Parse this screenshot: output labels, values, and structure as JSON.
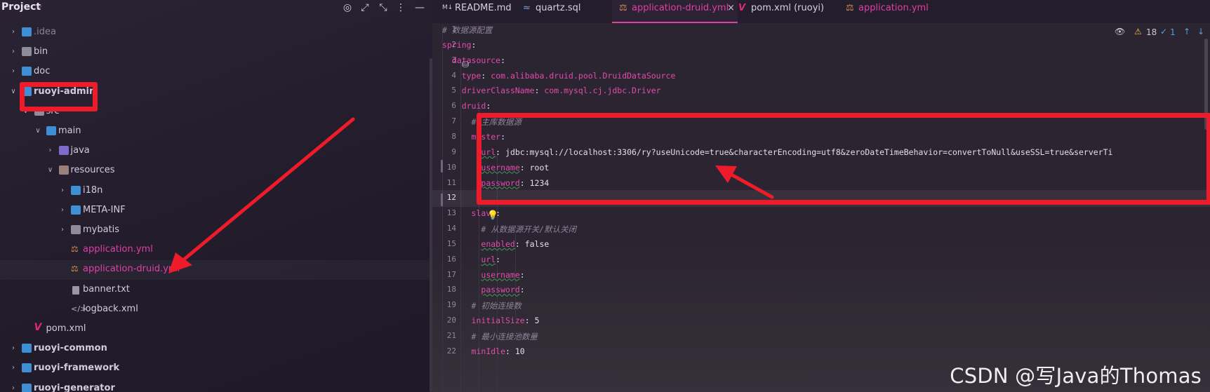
{
  "project": {
    "title": "Project",
    "tree": [
      {
        "label": ".idea",
        "depth": 0,
        "icon": "folder-icon",
        "expanded": false
      },
      {
        "label": "bin",
        "depth": 0,
        "icon": "folder-icon",
        "expanded": false
      },
      {
        "label": "doc",
        "depth": 0,
        "icon": "folder-icon",
        "expanded": false
      },
      {
        "label": "ruoyi-admin",
        "depth": 0,
        "icon": "module-icon",
        "expanded": true
      },
      {
        "label": "src",
        "depth": 1,
        "icon": "folder-icon",
        "expanded": true
      },
      {
        "label": "main",
        "depth": 2,
        "icon": "folder-icon",
        "expanded": true
      },
      {
        "label": "java",
        "depth": 3,
        "icon": "source-folder-icon",
        "expanded": false
      },
      {
        "label": "resources",
        "depth": 3,
        "icon": "resources-folder-icon",
        "expanded": true
      },
      {
        "label": "i18n",
        "depth": 4,
        "icon": "folder-icon",
        "expanded": false
      },
      {
        "label": "META-INF",
        "depth": 4,
        "icon": "folder-icon",
        "expanded": false
      },
      {
        "label": "mybatis",
        "depth": 4,
        "icon": "folder-icon",
        "expanded": false
      },
      {
        "label": "application.yml",
        "depth": 4,
        "icon": "yaml-file-icon"
      },
      {
        "label": "application-druid.yml",
        "depth": 4,
        "icon": "yaml-file-icon"
      },
      {
        "label": "banner.txt",
        "depth": 4,
        "icon": "text-file-icon"
      },
      {
        "label": "logback.xml",
        "depth": 4,
        "icon": "xml-file-icon"
      },
      {
        "label": "pom.xml",
        "depth": 1,
        "icon": "maven-icon"
      },
      {
        "label": "ruoyi-common",
        "depth": 0,
        "icon": "module-icon",
        "expanded": false
      },
      {
        "label": "ruoyi-framework",
        "depth": 0,
        "icon": "module-icon",
        "expanded": false
      },
      {
        "label": "ruoyi-generator",
        "depth": 0,
        "icon": "module-icon",
        "expanded": false
      }
    ]
  },
  "tabs": [
    {
      "label": "README.md",
      "icon": "markdown-icon"
    },
    {
      "label": "quartz.sql",
      "icon": "sql-icon"
    },
    {
      "label": "application-druid.yml",
      "icon": "yaml-file-icon",
      "active": true,
      "close": "×"
    },
    {
      "label": "pom.xml (ruoyi)",
      "icon": "maven-icon"
    },
    {
      "label": "application.yml",
      "icon": "yaml-file-icon"
    }
  ],
  "inspections": {
    "warnings": "18",
    "weak_warnings": "1"
  },
  "lines": [
    {
      "n": "1",
      "parts": [
        [
          "cmt",
          "# 数据源配置"
        ]
      ]
    },
    {
      "n": "2",
      "parts": [
        [
          "k",
          "spring"
        ],
        [
          "v",
          ":"
        ]
      ]
    },
    {
      "n": "3",
      "parts": [
        [
          "v",
          "  "
        ],
        [
          "k",
          "datasource"
        ],
        [
          "v",
          ":"
        ]
      ]
    },
    {
      "n": "4",
      "parts": [
        [
          "v",
          "    "
        ],
        [
          "k",
          "type"
        ],
        [
          "v",
          ": "
        ],
        [
          "cls",
          "com.alibaba.druid.pool.DruidDataSource"
        ]
      ]
    },
    {
      "n": "5",
      "parts": [
        [
          "v",
          "    "
        ],
        [
          "k",
          "driverClassName"
        ],
        [
          "v",
          ": "
        ],
        [
          "cls",
          "com.mysql.cj.jdbc.Driver"
        ]
      ]
    },
    {
      "n": "6",
      "parts": [
        [
          "v",
          "    "
        ],
        [
          "k",
          "druid"
        ],
        [
          "v",
          ":"
        ]
      ]
    },
    {
      "n": "7",
      "parts": [
        [
          "v",
          "      "
        ],
        [
          "cmt",
          "# 主库数据源"
        ]
      ]
    },
    {
      "n": "8",
      "parts": [
        [
          "v",
          "      "
        ],
        [
          "k",
          "master"
        ],
        [
          "v",
          ":"
        ]
      ]
    },
    {
      "n": "9",
      "parts": [
        [
          "v",
          "        "
        ],
        [
          "k sq",
          "url"
        ],
        [
          "v",
          ": jdbc:mysql://localhost:3306/ry?useUnicode=true&characterEncoding=utf8&zeroDateTimeBehavior=convertToNull&useSSL=true&serverTi"
        ]
      ]
    },
    {
      "n": "10",
      "parts": [
        [
          "v",
          "        "
        ],
        [
          "k sq",
          "username"
        ],
        [
          "v",
          ": root"
        ]
      ]
    },
    {
      "n": "11",
      "parts": [
        [
          "v",
          "        "
        ],
        [
          "k sq",
          "password"
        ],
        [
          "v",
          ": 1234"
        ]
      ]
    },
    {
      "n": "12",
      "parts": []
    },
    {
      "n": "13",
      "parts": [
        [
          "v",
          "      "
        ],
        [
          "k",
          "slave"
        ],
        [
          "v",
          ":"
        ]
      ]
    },
    {
      "n": "14",
      "parts": [
        [
          "v",
          "        "
        ],
        [
          "cmt",
          "# 从数据源开关/默认关闭"
        ]
      ]
    },
    {
      "n": "15",
      "parts": [
        [
          "v",
          "        "
        ],
        [
          "k sq",
          "enabled"
        ],
        [
          "v",
          ": false"
        ]
      ]
    },
    {
      "n": "16",
      "parts": [
        [
          "v",
          "        "
        ],
        [
          "k sq",
          "url"
        ],
        [
          "v",
          ":"
        ]
      ]
    },
    {
      "n": "17",
      "parts": [
        [
          "v",
          "        "
        ],
        [
          "k sq",
          "username"
        ],
        [
          "v",
          ":"
        ]
      ]
    },
    {
      "n": "18",
      "parts": [
        [
          "v",
          "        "
        ],
        [
          "k sq",
          "password"
        ],
        [
          "v",
          ":"
        ]
      ]
    },
    {
      "n": "19",
      "parts": [
        [
          "v",
          "      "
        ],
        [
          "cmt",
          "# 初始连接数"
        ]
      ]
    },
    {
      "n": "20",
      "parts": [
        [
          "v",
          "      "
        ],
        [
          "k",
          "initialSize"
        ],
        [
          "v",
          ": 5"
        ]
      ]
    },
    {
      "n": "21",
      "parts": [
        [
          "v",
          "      "
        ],
        [
          "cmt",
          "# 最小连接池数量"
        ]
      ]
    },
    {
      "n": "22",
      "parts": [
        [
          "v",
          "      "
        ],
        [
          "k",
          "minIdle"
        ],
        [
          "v",
          ": 10"
        ]
      ]
    }
  ],
  "watermark": "CSDN @写Java的Thomas",
  "colors": {
    "accent": "#e03fa6",
    "annotation": "#ee1c2b",
    "bulb": "#f0c43a"
  }
}
